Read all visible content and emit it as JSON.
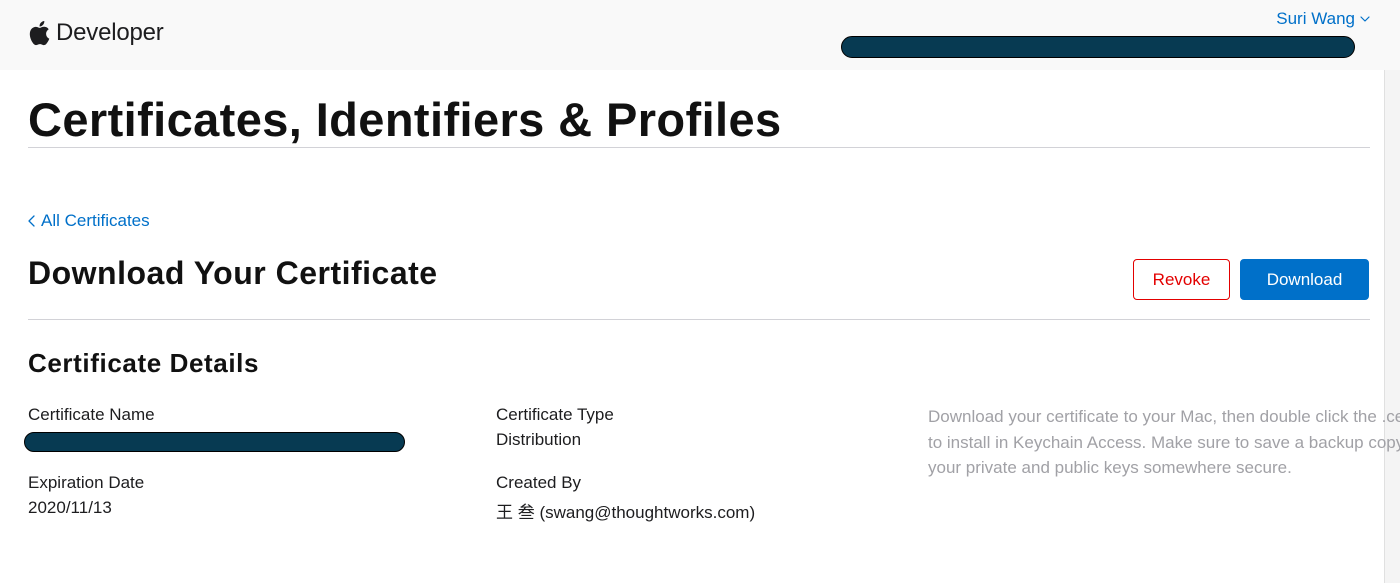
{
  "header": {
    "brand": "Developer",
    "user_name": "Suri Wang"
  },
  "page": {
    "title": "Certificates, Identifiers & Profiles",
    "back_link": "All Certificates",
    "section_title": "Download Your Certificate"
  },
  "actions": {
    "revoke_label": "Revoke",
    "download_label": "Download"
  },
  "details": {
    "title": "Certificate Details",
    "name_label": "Certificate Name",
    "type_label": "Certificate Type",
    "type_value": "Distribution",
    "expiration_label": "Expiration Date",
    "expiration_value": "2020/11/13",
    "created_by_label": "Created By",
    "created_by_value": "王 叁 (swang@thoughtworks.com)",
    "help_text": "Download your certificate to your Mac, then double click the .cer file to install in Keychain Access. Make sure to save a backup copy of your private and public keys somewhere secure."
  },
  "colors": {
    "link": "#0070c9",
    "primary_button": "#0070c9",
    "destructive": "#e30000",
    "redaction": "#073a52"
  }
}
